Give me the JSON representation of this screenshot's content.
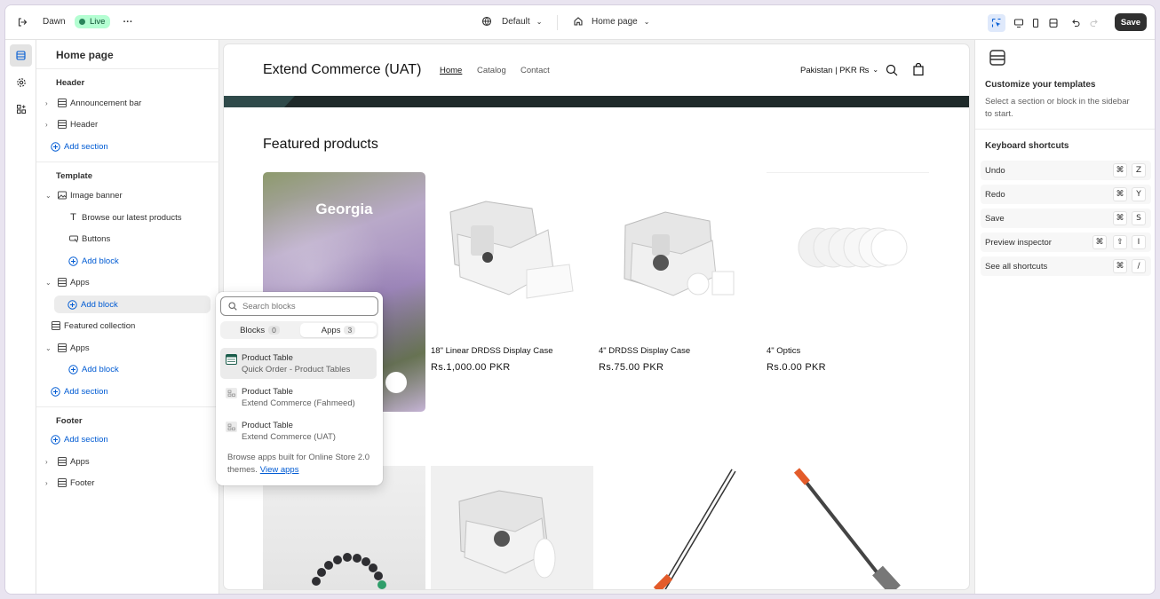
{
  "topbar": {
    "theme_name": "Dawn",
    "live_badge": "Live",
    "more_label": "···",
    "template_select": "Default",
    "page_select": "Home page",
    "save_label": "Save"
  },
  "sidebar": {
    "title": "Home page",
    "header_group": "Header",
    "announcement_bar": "Announcement bar",
    "header_item": "Header",
    "add_section_1": "Add section",
    "template_group": "Template",
    "image_banner": "Image banner",
    "browse_block": "Browse our latest products",
    "buttons_block": "Buttons",
    "add_block_1": "Add block",
    "apps_1": "Apps",
    "add_block_2": "Add block",
    "featured_collection": "Featured collection",
    "apps_2": "Apps",
    "add_block_3": "Add block",
    "add_section_2": "Add section",
    "footer_group": "Footer",
    "add_section_3": "Add section",
    "apps_3": "Apps",
    "footer_item": "Footer"
  },
  "store": {
    "logo": "Extend Commerce (UAT)",
    "nav": [
      "Home",
      "Catalog",
      "Contact"
    ],
    "locale": "Pakistan | PKR ₨",
    "featured_heading": "Featured products",
    "banner_text": "Georgia",
    "products": [
      {
        "title": "",
        "price": ""
      },
      {
        "title": "18\" Linear DRDSS Display Case",
        "price": "Rs.1,000.00 PKR"
      },
      {
        "title": "4\" DRDSS Display Case",
        "price": "Rs.75.00 PKR"
      },
      {
        "title": "4\" Optics",
        "price": "Rs.0.00 PKR"
      }
    ]
  },
  "popup": {
    "search_placeholder": "Search blocks",
    "tab_blocks": "Blocks",
    "tab_blocks_count": "0",
    "tab_apps": "Apps",
    "tab_apps_count": "3",
    "items": [
      {
        "title": "Product Table",
        "subtitle": "Quick Order - Product Tables"
      },
      {
        "title": "Product Table",
        "subtitle": "Extend Commerce (Fahmeed)"
      },
      {
        "title": "Product Table",
        "subtitle": "Extend Commerce (UAT)"
      }
    ],
    "footer_text_1": "Browse apps built for Online Store 2.0",
    "footer_text_2": "themes.",
    "footer_link": "View apps"
  },
  "rpanel": {
    "heading": "Customize your templates",
    "description_1": "Select a section or block in the sidebar",
    "description_2": "to start.",
    "shortcuts_heading": "Keyboard shortcuts",
    "shortcuts": [
      {
        "label": "Undo",
        "keys": [
          "⌘",
          "Z"
        ]
      },
      {
        "label": "Redo",
        "keys": [
          "⌘",
          "Y"
        ]
      },
      {
        "label": "Save",
        "keys": [
          "⌘",
          "S"
        ]
      },
      {
        "label": "Preview inspector",
        "keys": [
          "⌘",
          "⇧",
          "I"
        ]
      },
      {
        "label": "See all shortcuts",
        "keys": [
          "⌘",
          "/"
        ]
      }
    ]
  },
  "colors": {
    "accent_link": "#005bd3",
    "live_badge_bg": "#b4fed2",
    "save_button_bg": "#303030"
  }
}
